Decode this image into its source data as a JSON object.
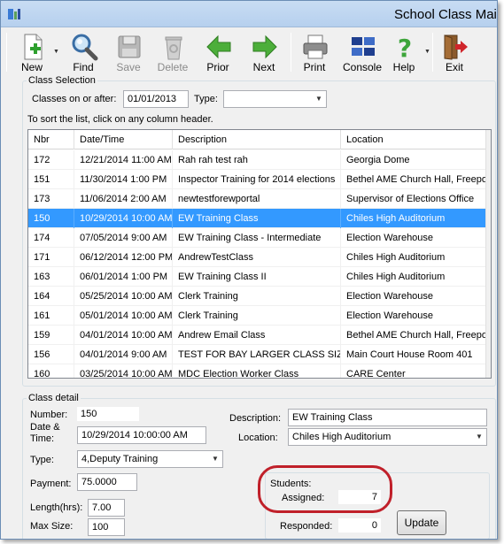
{
  "window": {
    "title": "School Class Mai"
  },
  "toolbar": {
    "new_label": "New",
    "find_label": "Find",
    "save_label": "Save",
    "delete_label": "Delete",
    "prior_label": "Prior",
    "next_label": "Next",
    "print_label": "Print",
    "console_label": "Console",
    "help_label": "Help",
    "exit_label": "Exit"
  },
  "class_selection": {
    "legend": "Class Selection",
    "classes_on_or_after_label": "Classes on or after:",
    "classes_on_or_after_value": "01/01/2013",
    "type_label": "Type:",
    "type_value": "",
    "sort_hint": "To sort the list, click on any column header.",
    "columns": [
      "Nbr",
      "Date/Time",
      "Description",
      "Location"
    ],
    "rows": [
      [
        "172",
        "12/21/2014 11:00 AM",
        "Rah rah test rah",
        "Georgia Dome"
      ],
      [
        "151",
        "11/30/2014 1:00 PM",
        "Inspector Training for 2014 elections",
        "Bethel AME Church Hall, Freeport"
      ],
      [
        "173",
        "11/06/2014 2:00 AM",
        "newtestforewportal",
        "Supervisor of Elections Office"
      ],
      [
        "150",
        "10/29/2014 10:00 AM",
        "EW Training Class",
        "Chiles High Auditorium"
      ],
      [
        "174",
        "07/05/2014 9:00 AM",
        "EW Training Class - Intermediate",
        "Election Warehouse"
      ],
      [
        "171",
        "06/12/2014 12:00 PM",
        "AndrewTestClass",
        "Chiles High Auditorium"
      ],
      [
        "163",
        "06/01/2014 1:00 PM",
        "EW Training Class II",
        "Chiles High Auditorium"
      ],
      [
        "164",
        "05/25/2014 10:00 AM",
        "Clerk Training",
        "Election Warehouse"
      ],
      [
        "161",
        "05/01/2014 10:00 AM",
        "Clerk Training",
        "Election Warehouse"
      ],
      [
        "159",
        "04/01/2014 10:00 AM",
        "Andrew Email Class",
        "Bethel AME Church Hall, Freeport"
      ],
      [
        "156",
        "04/01/2014 9:00 AM",
        "TEST FOR BAY LARGER CLASS SIZE",
        "Main Court House Room 401"
      ],
      [
        "160",
        "03/25/2014 10:00 AM",
        "MDC Election Worker Class",
        "CARE Center"
      ]
    ],
    "selected_row_number": "150"
  },
  "class_detail": {
    "legend": "Class detail",
    "number_label": "Number:",
    "number_value": "150",
    "date_label_1": "Date &",
    "date_label_2": "Time:",
    "date_value": "10/29/2014 10:00:00 AM",
    "type_label": "Type:",
    "type_value": "4,Deputy Training",
    "payment_label": "Payment:",
    "payment_value": "75.0000",
    "length_label": "Length(hrs):",
    "length_value": "7.00",
    "max_size_label": "Max Size:",
    "max_size_value": "100",
    "description_label": "Description:",
    "description_value": "EW Training Class",
    "location_label": "Location:",
    "location_value": "Chiles High Auditorium",
    "students_label": "Students:",
    "assigned_label": "Assigned:",
    "assigned_value": "7",
    "responded_label": "Responded:",
    "responded_value": "0",
    "update_label": "Update"
  },
  "colors": {
    "selection": "#3399ff",
    "highlight_ring": "#c0202a"
  }
}
